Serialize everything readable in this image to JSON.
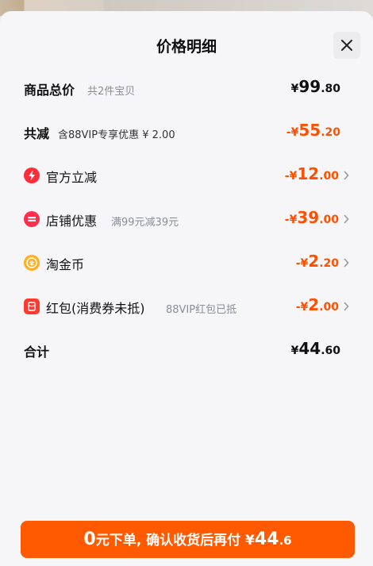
{
  "sheet": {
    "title": "价格明细"
  },
  "rows": {
    "total": {
      "label": "商品总价",
      "sub": "共2件宝贝",
      "currency": "¥",
      "int": "99",
      "dec": ".80"
    },
    "reduce": {
      "label": "共减",
      "sub": "含88VIP专享优惠 ¥ 2.00",
      "currency": "-¥",
      "int": "55",
      "dec": ".20"
    },
    "official": {
      "label": "官方立减",
      "sub": "",
      "currency": "-¥",
      "int": "12",
      "dec": ".00"
    },
    "shop": {
      "label": "店铺优惠",
      "sub": "满99元减39元",
      "currency": "-¥",
      "int": "39",
      "dec": ".00"
    },
    "coin": {
      "label": "淘金币",
      "sub": "",
      "currency": "-¥",
      "int": "2",
      "dec": ".20"
    },
    "redpacket": {
      "label": "红包(消费券未抵)",
      "sub": "88VIP红包已抵",
      "currency": "-¥",
      "int": "2",
      "dec": ".00"
    },
    "sum": {
      "label": "合计",
      "currency": "¥",
      "int": "44",
      "dec": ".60"
    }
  },
  "cta": {
    "zero": "0",
    "text": "元下单, 确认收货后再付 ¥",
    "amount_int": "44",
    "amount_dec": ".6"
  },
  "colors": {
    "accent": "#ff5000",
    "button": "#ff5a00",
    "official_icon": "#ff2d3a",
    "shop_icon": "#ff2e4a",
    "coin_icon": "#ffb020",
    "redpacket_icon": "#ff3b30"
  },
  "icons": {
    "close": "close-icon",
    "official": "lightning-icon",
    "shop": "shop-coupon-icon",
    "coin": "gold-coin-icon",
    "redpacket": "red-packet-icon",
    "chevron": "chevron-right-icon"
  }
}
